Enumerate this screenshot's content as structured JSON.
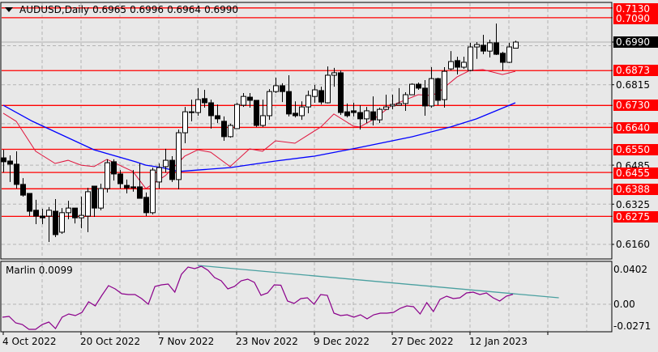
{
  "header": {
    "symbol": "AUDUSD,Daily",
    "open": "0.6965",
    "high": "0.6996",
    "low": "0.6964",
    "close": "0.6990"
  },
  "indicator": {
    "label": "Marlin 0.0099"
  },
  "colors": {
    "background": "#e8e8e8",
    "level": "#ff0000",
    "ma_fast": "#e0143c",
    "ma_slow": "#0000ff",
    "marlin": "#8b008b",
    "trendline": "#4aa0a0"
  },
  "price_axis": {
    "bid_label": "0.6990",
    "level_labels": [
      "0.7130",
      "0.7090",
      "0.6873",
      "0.6730",
      "0.6640",
      "0.6550",
      "0.6455",
      "0.6388",
      "0.6275"
    ],
    "tick_labels": [
      "0.6815",
      "0.6485",
      "0.6325",
      "0.6160"
    ]
  },
  "indicator_axis": {
    "tick_labels": [
      "0.0402",
      "0.00",
      "-0.0271"
    ]
  },
  "date_axis": {
    "labels": [
      "4 Oct 2022",
      "20 Oct 2022",
      "7 Nov 2022",
      "23 Nov 2022",
      "9 Dec 2022",
      "27 Dec 2022",
      "12 Jan 2023"
    ]
  },
  "chart_data": [
    {
      "type": "candlestick",
      "title": "AUDUSD,Daily",
      "ylim": [
        0.613,
        0.716
      ],
      "levels": [
        0.713,
        0.709,
        0.6873,
        0.673,
        0.664,
        0.655,
        0.6455,
        0.6388,
        0.6275
      ],
      "bid": 0.699,
      "grid_prices": [
        0.6975,
        0.6815,
        0.6655,
        0.6485,
        0.6325,
        0.616
      ],
      "ohlc": [
        [
          0.6515,
          0.6548,
          0.6455,
          0.6499
        ],
        [
          0.6502,
          0.6525,
          0.6416,
          0.6489
        ],
        [
          0.6489,
          0.6542,
          0.6389,
          0.6406
        ],
        [
          0.6406,
          0.6432,
          0.6356,
          0.6362
        ],
        [
          0.6369,
          0.6369,
          0.6276,
          0.6296
        ],
        [
          0.63,
          0.6343,
          0.6243,
          0.6276
        ],
        [
          0.6276,
          0.6306,
          0.6243,
          0.6269
        ],
        [
          0.6276,
          0.6313,
          0.617,
          0.63
        ],
        [
          0.6296,
          0.6346,
          0.619,
          0.62
        ],
        [
          0.621,
          0.6309,
          0.6203,
          0.629
        ],
        [
          0.629,
          0.6339,
          0.6263,
          0.6309
        ],
        [
          0.6309,
          0.6309,
          0.6246,
          0.6269
        ],
        [
          0.6269,
          0.6356,
          0.6226,
          0.6279
        ],
        [
          0.6276,
          0.6392,
          0.621,
          0.6376
        ],
        [
          0.6399,
          0.6399,
          0.6273,
          0.6309
        ],
        [
          0.6309,
          0.6409,
          0.63,
          0.6389
        ],
        [
          0.6389,
          0.6509,
          0.6373,
          0.6495
        ],
        [
          0.6499,
          0.6509,
          0.6422,
          0.6449
        ],
        [
          0.6449,
          0.6465,
          0.6389,
          0.6409
        ],
        [
          0.6402,
          0.6426,
          0.6369,
          0.6392
        ],
        [
          0.6396,
          0.6465,
          0.6376,
          0.6392
        ],
        [
          0.6396,
          0.6492,
          0.6349,
          0.6349
        ],
        [
          0.6353,
          0.6373,
          0.6276,
          0.629
        ],
        [
          0.629,
          0.6475,
          0.6283,
          0.6465
        ],
        [
          0.6416,
          0.6492,
          0.6389,
          0.6475
        ],
        [
          0.6479,
          0.6552,
          0.6455,
          0.6505
        ],
        [
          0.6505,
          0.6522,
          0.6416,
          0.6426
        ],
        [
          0.6426,
          0.6631,
          0.6386,
          0.6618
        ],
        [
          0.6618,
          0.6724,
          0.6575,
          0.6704
        ],
        [
          0.6704,
          0.6754,
          0.6665,
          0.6701
        ],
        [
          0.6701,
          0.6801,
          0.6688,
          0.6754
        ],
        [
          0.6758,
          0.6794,
          0.6721,
          0.6741
        ],
        [
          0.6741,
          0.6754,
          0.6635,
          0.6688
        ],
        [
          0.6688,
          0.6734,
          0.6658,
          0.6675
        ],
        [
          0.6665,
          0.6685,
          0.6585,
          0.6602
        ],
        [
          0.6602,
          0.6655,
          0.6598,
          0.6648
        ],
        [
          0.6635,
          0.6741,
          0.6635,
          0.6734
        ],
        [
          0.6731,
          0.6781,
          0.6724,
          0.6767
        ],
        [
          0.6764,
          0.6781,
          0.6721,
          0.6751
        ],
        [
          0.6751,
          0.6751,
          0.6642,
          0.6648
        ],
        [
          0.6648,
          0.6754,
          0.6642,
          0.6688
        ],
        [
          0.6688,
          0.6797,
          0.6671,
          0.6787
        ],
        [
          0.6787,
          0.6844,
          0.6781,
          0.6811
        ],
        [
          0.6811,
          0.6821,
          0.6744,
          0.6787
        ],
        [
          0.6787,
          0.6854,
          0.6685,
          0.6695
        ],
        [
          0.6698,
          0.6747,
          0.6681,
          0.6688
        ],
        [
          0.6688,
          0.6747,
          0.6671,
          0.6724
        ],
        [
          0.6724,
          0.6791,
          0.6698,
          0.6771
        ],
        [
          0.6767,
          0.6814,
          0.6741,
          0.6794
        ],
        [
          0.6791,
          0.6807,
          0.6734,
          0.6744
        ],
        [
          0.6741,
          0.689,
          0.6738,
          0.6854
        ],
        [
          0.6854,
          0.6884,
          0.6807,
          0.6864
        ],
        [
          0.6864,
          0.6874,
          0.6691,
          0.6701
        ],
        [
          0.6704,
          0.6738,
          0.6681,
          0.6688
        ],
        [
          0.6708,
          0.6741,
          0.6685,
          0.6701
        ],
        [
          0.6701,
          0.6731,
          0.6631,
          0.6675
        ],
        [
          0.6675,
          0.6724,
          0.6658,
          0.6708
        ],
        [
          0.6704,
          0.6767,
          0.6648,
          0.6671
        ],
        [
          0.6671,
          0.6721,
          0.6658,
          0.6714
        ],
        [
          0.6714,
          0.6774,
          0.6714,
          0.6724
        ],
        [
          0.6728,
          0.6774,
          0.6714,
          0.6734
        ],
        [
          0.6731,
          0.6801,
          0.6731,
          0.6738
        ],
        [
          0.6738,
          0.6784,
          0.6708,
          0.6774
        ],
        [
          0.6774,
          0.6821,
          0.6774,
          0.6817
        ],
        [
          0.6817,
          0.6824,
          0.6794,
          0.6801
        ],
        [
          0.6801,
          0.6834,
          0.6688,
          0.6728
        ],
        [
          0.6728,
          0.6887,
          0.6721,
          0.684
        ],
        [
          0.684,
          0.6844,
          0.6731,
          0.6751
        ],
        [
          0.6754,
          0.6887,
          0.6721,
          0.687
        ],
        [
          0.688,
          0.6953,
          0.6874,
          0.691
        ],
        [
          0.6914,
          0.693,
          0.6857,
          0.6887
        ],
        [
          0.6887,
          0.693,
          0.688,
          0.6907
        ],
        [
          0.6874,
          0.6987,
          0.687,
          0.697
        ],
        [
          0.697,
          0.699,
          0.6921,
          0.698
        ],
        [
          0.6977,
          0.702,
          0.694,
          0.6953
        ],
        [
          0.6953,
          0.7,
          0.6927,
          0.6987
        ],
        [
          0.6987,
          0.7066,
          0.6937,
          0.694
        ],
        [
          0.6944,
          0.695,
          0.6874,
          0.6907
        ],
        [
          0.6907,
          0.6987,
          0.6904,
          0.697
        ],
        [
          0.6965,
          0.6996,
          0.6964,
          0.699
        ]
      ],
      "ma_fast": [
        [
          0,
          0.6698
        ],
        [
          2,
          0.6665
        ],
        [
          5,
          0.6542
        ],
        [
          8,
          0.6492
        ],
        [
          10,
          0.6505
        ],
        [
          12,
          0.6485
        ],
        [
          14,
          0.6479
        ],
        [
          16,
          0.6509
        ],
        [
          20,
          0.6459
        ],
        [
          22,
          0.6389
        ],
        [
          25,
          0.6442
        ],
        [
          28,
          0.6522
        ],
        [
          30,
          0.6548
        ],
        [
          32,
          0.6538
        ],
        [
          35,
          0.6479
        ],
        [
          38,
          0.6552
        ],
        [
          40,
          0.6542
        ],
        [
          42,
          0.6585
        ],
        [
          45,
          0.6575
        ],
        [
          49,
          0.6642
        ],
        [
          51,
          0.6695
        ],
        [
          54,
          0.6645
        ],
        [
          55,
          0.6642
        ],
        [
          57,
          0.6671
        ],
        [
          60,
          0.6731
        ],
        [
          64,
          0.6774
        ],
        [
          66,
          0.6771
        ],
        [
          67,
          0.6781
        ],
        [
          70,
          0.6847
        ],
        [
          72,
          0.6874
        ],
        [
          74,
          0.6877
        ],
        [
          77,
          0.6857
        ],
        [
          79,
          0.687
        ]
      ],
      "ma_slow": [
        [
          0,
          0.6731
        ],
        [
          4.5,
          0.6665
        ],
        [
          14,
          0.6548
        ],
        [
          20.4,
          0.6499
        ],
        [
          22,
          0.6485
        ],
        [
          24.5,
          0.6475
        ],
        [
          27,
          0.6459
        ],
        [
          35,
          0.6475
        ],
        [
          42,
          0.6502
        ],
        [
          48,
          0.6522
        ],
        [
          54.5,
          0.6555
        ],
        [
          63,
          0.6601
        ],
        [
          69,
          0.6642
        ],
        [
          73,
          0.6675
        ],
        [
          79,
          0.6741
        ]
      ]
    },
    {
      "type": "line",
      "title": "Marlin 0.0099",
      "ylim": [
        -0.0271,
        0.0402
      ],
      "values": [
        -0.0128,
        -0.012,
        -0.0184,
        -0.02,
        -0.0248,
        -0.0248,
        -0.02,
        -0.0176,
        -0.024,
        -0.0128,
        -0.0096,
        -0.0112,
        -0.008,
        0.0024,
        -0.0016,
        0.0088,
        0.0184,
        0.0152,
        0.0104,
        0.0096,
        0.0096,
        0.0056,
        0,
        0.0176,
        0.0192,
        0.02,
        0.012,
        0.0296,
        0.0368,
        0.0352,
        0.0376,
        0.0336,
        0.0264,
        0.0232,
        0.0152,
        0.0176,
        0.0232,
        0.0248,
        0.0216,
        0.0088,
        0.0112,
        0.0192,
        0.0188,
        0.0032,
        0.0008,
        0.0056,
        0.0064,
        0,
        0.0096,
        0.0088,
        -0.0088,
        -0.0112,
        -0.0104,
        -0.0128,
        -0.0104,
        -0.0144,
        -0.0104,
        -0.0088,
        -0.0088,
        -0.008,
        -0.004,
        -0.0016,
        -0.0024,
        -0.0096,
        0.0016,
        -0.0072,
        0.0048,
        0.008,
        0.0056,
        0.0064,
        0.0112,
        0.012,
        0.0096,
        0.0112,
        0.0064,
        0.0032,
        0.008,
        0.0099
      ],
      "trendline": [
        [
          30,
          0.0384
        ],
        [
          85.7,
          0.0064
        ]
      ]
    }
  ]
}
